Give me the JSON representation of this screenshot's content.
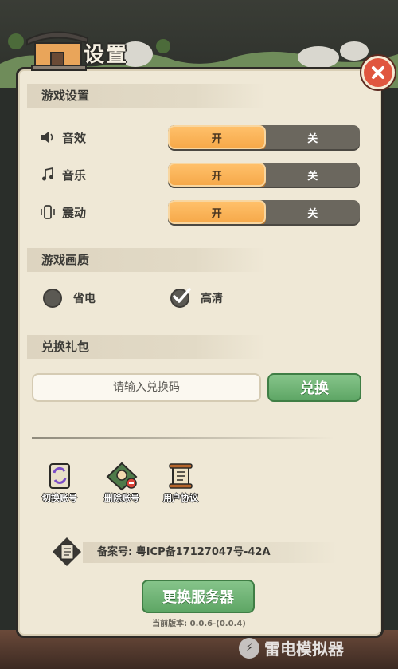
{
  "header": {
    "title": "设置"
  },
  "sections": {
    "game_settings": "游戏设置",
    "quality": "游戏画质",
    "gift": "兑换礼包"
  },
  "settings": [
    {
      "label": "音效",
      "icon": "speaker-icon",
      "on": "开",
      "off": "关",
      "value": "on"
    },
    {
      "label": "音乐",
      "icon": "music-note-icon",
      "on": "开",
      "off": "关",
      "value": "on"
    },
    {
      "label": "震动",
      "icon": "vibrate-icon",
      "on": "开",
      "off": "关",
      "value": "on"
    }
  ],
  "quality": {
    "options": [
      {
        "label": "省电",
        "selected": false
      },
      {
        "label": "高清",
        "selected": true
      }
    ]
  },
  "gift": {
    "placeholder": "请输入兑换码",
    "button": "兑换"
  },
  "account": {
    "switch": "切换账号",
    "delete": "删除账号",
    "agreement": "用户协议"
  },
  "icp": {
    "text": "备案号: 粤ICP备17127047号-42A"
  },
  "server_button": "更换服务器",
  "version": "当前版本: 0.0.6-(0.0.4)",
  "watermark": "雷电模拟器",
  "colors": {
    "accent_orange": "#f6a94a",
    "accent_green": "#5ea665",
    "close_red": "#e0563f",
    "panel": "#efe8d6"
  }
}
